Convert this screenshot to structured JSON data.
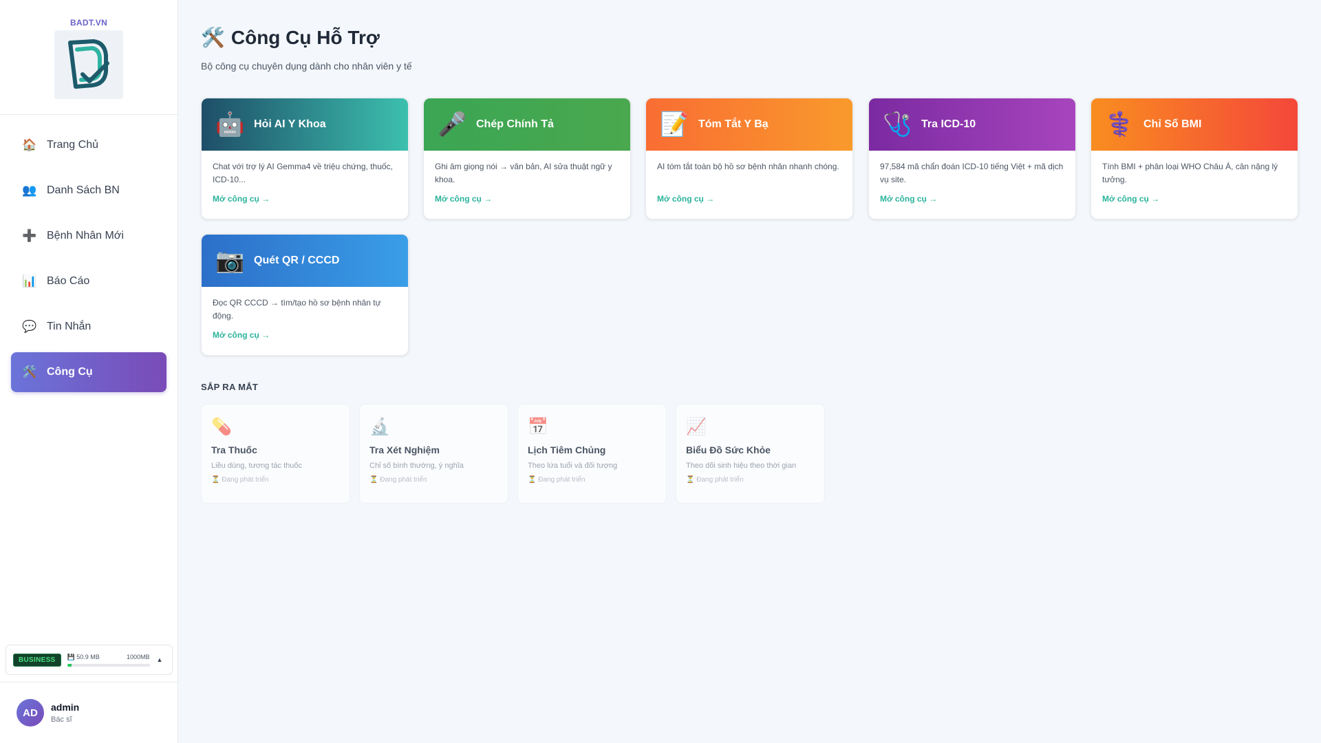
{
  "brand": {
    "name": "BADT.VN"
  },
  "sidebar": {
    "items": [
      {
        "label": "Trang Chủ",
        "icon": "🏠"
      },
      {
        "label": "Danh Sách BN",
        "icon": "👥"
      },
      {
        "label": "Bệnh Nhân Mới",
        "icon": "➕"
      },
      {
        "label": "Báo Cáo",
        "icon": "📊"
      },
      {
        "label": "Tin Nhắn",
        "icon": "💬"
      },
      {
        "label": "Công Cụ",
        "icon": "🛠️"
      }
    ]
  },
  "plan": {
    "badge": "BUSINESS",
    "used": "💾 50.9 MB",
    "total": "1000MB",
    "used_fraction": 0.051,
    "toggle": "▲"
  },
  "user": {
    "initials": "AD",
    "name": "admin",
    "role": "Bác sĩ"
  },
  "header": {
    "icon": "🛠️",
    "title": "Công Cụ Hỗ Trợ",
    "subtitle": "Bộ công cụ chuyên dụng dành cho nhân viên y tế"
  },
  "tools": [
    {
      "title": "Hỏi AI Y Khoa",
      "icon": "🤖",
      "desc": "Chat với trợ lý AI Gemma4 về triệu chứng, thuốc, ICD-10...",
      "link": "Mở công cụ →"
    },
    {
      "title": "Chép Chính Tả",
      "icon": "🎤",
      "desc": "Ghi âm giọng nói → văn bản, AI sửa thuật ngữ y khoa.",
      "link": "Mở công cụ →"
    },
    {
      "title": "Tóm Tắt Y Bạ",
      "icon": "📝",
      "desc": "AI tóm tắt toàn bộ hồ sơ bệnh nhân nhanh chóng.",
      "link": "Mở công cụ →"
    },
    {
      "title": "Tra ICD-10",
      "icon": "🩺",
      "desc": "97,584 mã chẩn đoán ICD-10 tiếng Việt + mã dịch vụ site.",
      "link": "Mở công cụ →"
    },
    {
      "title": "Chỉ Số BMI",
      "icon": "⚕️",
      "desc": "Tính BMI + phân loại WHO Châu Á, cân nặng lý tưởng.",
      "link": "Mở công cụ →"
    },
    {
      "title": "Quét QR / CCCD",
      "icon": "📷",
      "desc": "Đọc QR CCCD → tìm/tạo hồ sơ bệnh nhân tự động.",
      "link": "Mở công cụ →"
    }
  ],
  "upcoming": {
    "label": "SẮP RA MẮT",
    "items": [
      {
        "title": "Tra Thuốc",
        "icon": "💊",
        "desc": "Liều dùng, tương tác thuốc",
        "status": "⏳ Đang phát triển"
      },
      {
        "title": "Tra Xét Nghiệm",
        "icon": "🔬",
        "desc": "Chỉ số bình thường, ý nghĩa",
        "status": "⏳ Đang phát triển"
      },
      {
        "title": "Lịch Tiêm Chủng",
        "icon": "📅",
        "desc": "Theo lứa tuổi và đối tượng",
        "status": "⏳ Đang phát triển"
      },
      {
        "title": "Biểu Đồ Sức Khỏe",
        "icon": "📈",
        "desc": "Theo dõi sinh hiệu theo thời gian",
        "status": "⏳ Đang phát triển"
      }
    ]
  }
}
